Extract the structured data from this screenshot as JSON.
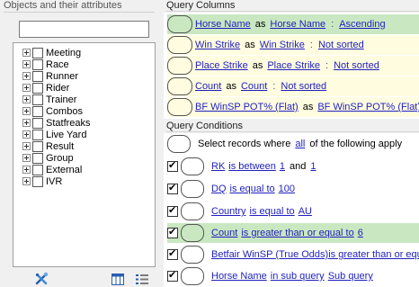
{
  "left": {
    "header": "Objects and their attributes",
    "search_value": "",
    "tree": [
      {
        "label": "Meeting"
      },
      {
        "label": "Race"
      },
      {
        "label": "Runner"
      },
      {
        "label": "Rider"
      },
      {
        "label": "Trainer"
      },
      {
        "label": "Combos"
      },
      {
        "label": "Statfreaks"
      },
      {
        "label": "Live Yard"
      },
      {
        "label": "Result"
      },
      {
        "label": "Group"
      },
      {
        "label": "External"
      },
      {
        "label": "IVR"
      }
    ],
    "footer_icons": [
      "tools-icon",
      "columns-icon",
      "list-icon"
    ]
  },
  "columns": {
    "header": "Query Columns",
    "rows": [
      {
        "field": "Horse Name",
        "as": "as",
        "alias": "Horse Name",
        "colon": ":",
        "sort": "Ascending"
      },
      {
        "field": "Win Strike",
        "as": "as",
        "alias": "Win Strike",
        "colon": ":",
        "sort": "Not sorted"
      },
      {
        "field": "Place Strike",
        "as": "as",
        "alias": "Place Strike",
        "colon": ":",
        "sort": "Not sorted"
      },
      {
        "field": "Count",
        "as": "as",
        "alias": "Count",
        "colon": ":",
        "sort": "Not sorted"
      },
      {
        "field": "BF WinSP POT% (Flat)",
        "as": "as",
        "alias": "BF WinSP POT% (Flat)",
        "colon": ":",
        "sort": ""
      }
    ]
  },
  "conditions": {
    "header": "Query Conditions",
    "root": {
      "prefix": "Select records where",
      "quantifier": "all",
      "suffix": "of the following apply"
    },
    "rows": [
      {
        "field": "RK",
        "op": "is between",
        "v1": "1",
        "and": "and",
        "v2": "1"
      },
      {
        "field": "DQ",
        "op": "is equal to",
        "v1": "100"
      },
      {
        "field": "Country",
        "op": "is equal to",
        "v1": "AU"
      },
      {
        "field": "Count",
        "op": "is greater than or equal to",
        "v1": "6"
      },
      {
        "field": "Betfair WinSP (True Odds)",
        "op": "is greater than or equal t",
        "v1": ""
      },
      {
        "field": "Horse Name",
        "op": "in sub query",
        "v1": "Sub query"
      }
    ]
  },
  "colors": {
    "highlight_green": "#c9e8c1",
    "highlight_yellow": "#fffce0",
    "link_blue": "#1f1fbf"
  }
}
